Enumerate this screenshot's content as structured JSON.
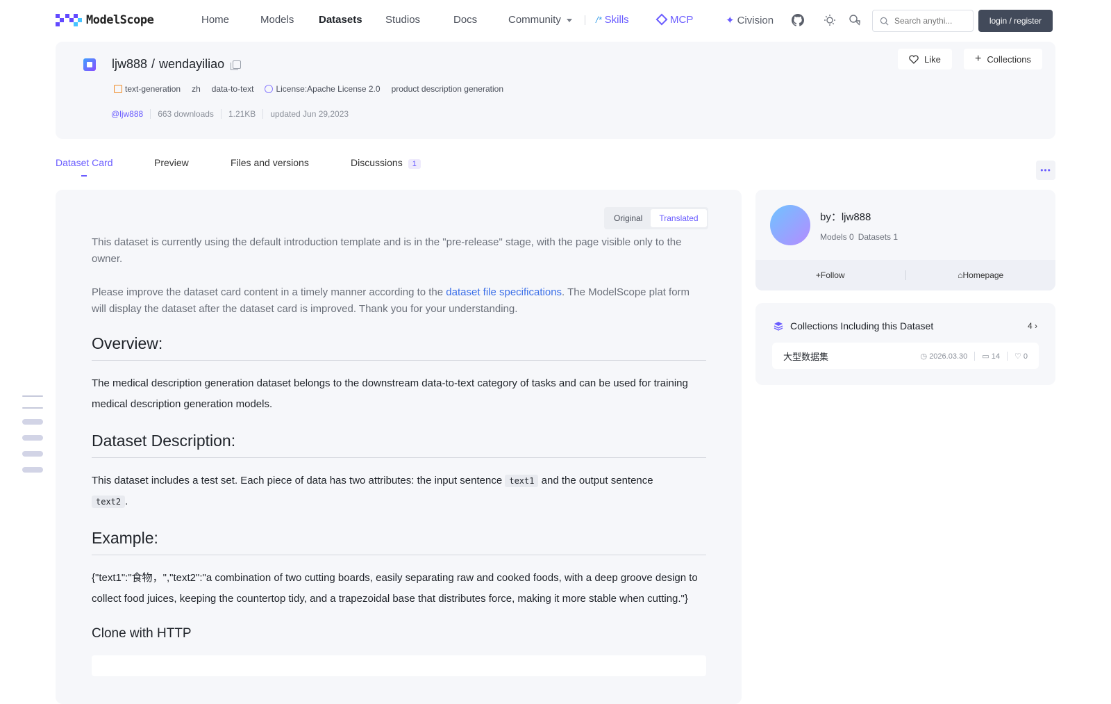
{
  "nav": {
    "logo": "ModelScope",
    "items": [
      "Home",
      "Models",
      "Datasets",
      "Studios",
      "Docs",
      "Community"
    ],
    "skills": "Skills",
    "mcp": "MCP",
    "civision": "Civision",
    "search_placeholder": "Search anythi...",
    "login": "login / register"
  },
  "dataset": {
    "owner": "ljw888",
    "sep": "/",
    "name": "wendayiliao",
    "tags": [
      "text-generation",
      "zh",
      "data-to-text",
      "License:Apache License 2.0",
      "product description generation"
    ],
    "meta": [
      "@ljw888",
      "663 downloads",
      "1.21KB",
      "updated Jun 29,2023"
    ],
    "like": "Like",
    "collections": "Collections"
  },
  "tabs": {
    "items": [
      "Dataset Card",
      "Preview",
      "Files and versions",
      "Discussions"
    ],
    "discussions_count": "1"
  },
  "card": {
    "toggle_original": "Original",
    "toggle_translated": "Translated",
    "note1": "This dataset is currently using the default introduction template and is in the \"pre-release\" stage, with the page visible only to the owner.",
    "note2_pre": "Please improve the dataset card content in a timely manner according to the ",
    "note2_link": "dataset file specifications",
    "note2_post": ". The ModelScope plat form will display the dataset after the dataset card is improved. Thank you for your understanding.",
    "h_overview": "Overview:",
    "p_overview": "The medical description generation dataset belongs to the downstream data-to-text category of tasks and can be used for training medical description generation models.",
    "h_desc": "Dataset Description:",
    "p_desc_pre": "This dataset includes a test set. Each piece of data has two attributes: the input sentence ",
    "code1": "text1",
    "p_desc_mid": " and the output sentence ",
    "code2": "text2",
    "p_desc_post": ".",
    "h_example": "Example:",
    "p_example": "{\"text1\":\"食物，\",\"text2\":\"a combination of two cutting boards, easily separating raw and cooked foods, with a deep groove design to collect food juices, keeping the countertop tidy, and a trapezoidal base that distributes force, making it more stable when cutting.\"}",
    "h_clone": "Clone with HTTP"
  },
  "author": {
    "by": "by：ljw888",
    "models": "Models 0",
    "datasets": "Datasets 1",
    "follow": "Follow",
    "homepage": "Homepage"
  },
  "collections_box": {
    "title": "Collections Including this Dataset",
    "count": "4",
    "row_name": "大型数据集",
    "row_date": "2026.03.30",
    "row_count": "14",
    "row_likes": "0"
  }
}
